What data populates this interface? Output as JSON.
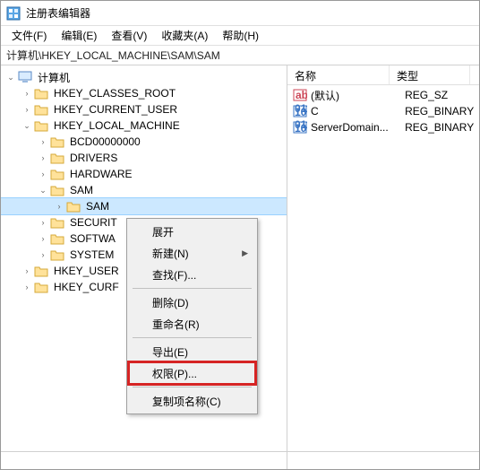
{
  "window": {
    "title": "注册表编辑器"
  },
  "menubar": {
    "file": "文件(F)",
    "edit": "编辑(E)",
    "view": "查看(V)",
    "favorites": "收藏夹(A)",
    "help": "帮助(H)"
  },
  "addressbar": {
    "path": "计算机\\HKEY_LOCAL_MACHINE\\SAM\\SAM"
  },
  "tree": {
    "root": "计算机",
    "hkcr": "HKEY_CLASSES_ROOT",
    "hkcu": "HKEY_CURRENT_USER",
    "hklm": "HKEY_LOCAL_MACHINE",
    "hklm_children": {
      "bcd": "BCD00000000",
      "drivers": "DRIVERS",
      "hardware": "HARDWARE",
      "sam": "SAM",
      "sam_sam": "SAM",
      "security": "SECURIT",
      "software": "SOFTWA",
      "system": "SYSTEM"
    },
    "hku": "HKEY_USER",
    "hkcc": "HKEY_CURF"
  },
  "list": {
    "headers": {
      "name": "名称",
      "type": "类型"
    },
    "rows": [
      {
        "name": "(默认)",
        "type": "REG_SZ",
        "icon": "string"
      },
      {
        "name": "C",
        "type": "REG_BINARY",
        "icon": "binary"
      },
      {
        "name": "ServerDomain...",
        "type": "REG_BINARY",
        "icon": "binary"
      }
    ]
  },
  "context_menu": {
    "expand": "展开",
    "new": "新建(N)",
    "find": "查找(F)...",
    "delete": "删除(D)",
    "rename": "重命名(R)",
    "export": "导出(E)",
    "permissions": "权限(P)...",
    "copy_key_name": "复制项名称(C)"
  },
  "statusbar": {
    "watermark": ""
  }
}
